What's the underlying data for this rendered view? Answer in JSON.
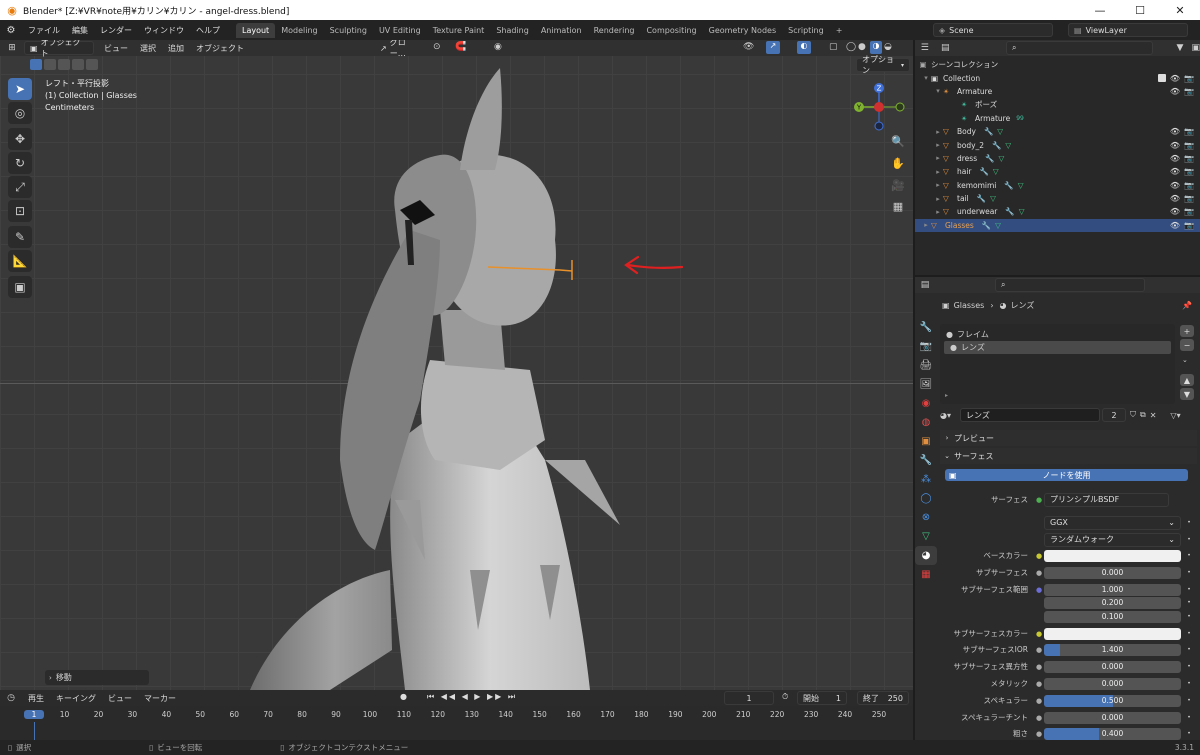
{
  "window": {
    "title": "Blender* [Z:¥VR¥note用¥カリン¥カリン - angel-dress.blend]",
    "minimize_glyph": "—",
    "maximize_glyph": "☐",
    "close_glyph": "✕"
  },
  "menubar": {
    "items": [
      "ファイル",
      "編集",
      "レンダー",
      "ウィンドウ",
      "ヘルプ"
    ],
    "workspace_tabs": [
      "Layout",
      "Modeling",
      "Sculpting",
      "UV Editing",
      "Texture Paint",
      "Shading",
      "Animation",
      "Rendering",
      "Compositing",
      "Geometry Nodes",
      "Scripting"
    ],
    "active_tab": "Layout",
    "add_tab": "+",
    "scene": "Scene",
    "view_layer": "ViewLayer"
  },
  "viewport": {
    "mode": "オブジェクト",
    "menu": [
      "ビュー",
      "選択",
      "追加",
      "オブジェクト"
    ],
    "transform_orientation": "グロー…",
    "options_label": "オプション",
    "overlay_lines": [
      "レフト・平行投影",
      "(1) Collection | Glasses",
      "Centimeters"
    ],
    "last_op_label": "移動",
    "gizmo_axes": {
      "x": "X",
      "y": "Y",
      "z": "Z"
    },
    "annotation_color": "#e02020",
    "glasses_color": "#e8902a"
  },
  "timeline": {
    "play_menu": "再生",
    "keying_menu": "キーイング",
    "view_menu": "ビュー",
    "marker_menu": "マーカー",
    "current_frame": "1",
    "start_label": "開始",
    "start_value": "1",
    "end_label": "終了",
    "end_value": "250",
    "ruler": [
      "1",
      "10",
      "20",
      "30",
      "40",
      "50",
      "60",
      "70",
      "80",
      "90",
      "100",
      "110",
      "120",
      "130",
      "140",
      "150",
      "160",
      "170",
      "180",
      "190",
      "200",
      "210",
      "220",
      "230",
      "240",
      "250"
    ]
  },
  "status": {
    "left": "選択",
    "middle": "ビューを回転",
    "right": "オブジェクトコンテクストメニュー",
    "version": "3.3.1"
  },
  "outliner": {
    "root": "シーンコレクション",
    "collection": "Collection",
    "rows": [
      {
        "name": "Armature",
        "icon": "armature-icon"
      },
      {
        "name": "ポーズ",
        "icon": "pose-icon"
      },
      {
        "name": "Armature",
        "icon": "armature-data-icon",
        "extra": "99"
      },
      {
        "name": "Body",
        "icon": "mesh-icon"
      },
      {
        "name": "body_2",
        "icon": "mesh-icon"
      },
      {
        "name": "dress",
        "icon": "mesh-icon"
      },
      {
        "name": "hair",
        "icon": "mesh-icon"
      },
      {
        "name": "kemomimi",
        "icon": "mesh-icon"
      },
      {
        "name": "tail",
        "icon": "mesh-icon"
      },
      {
        "name": "underwear",
        "icon": "mesh-icon"
      },
      {
        "name": "Glasses",
        "icon": "mesh-icon",
        "selected": true
      }
    ]
  },
  "properties": {
    "breadcrumb_object": "Glasses",
    "breadcrumb_material": "レンズ",
    "slots": [
      "フレイム",
      "レンズ"
    ],
    "active_slot": "レンズ",
    "material_name": "レンズ",
    "user_count": "2",
    "panel_preview": "プレビュー",
    "panel_surface": "サーフェス",
    "use_nodes": "ノードを使用",
    "surface_label": "サーフェス",
    "surface_value": "プリンシプルBSDF",
    "distribution": "GGX",
    "subsurface_method": "ランダムウォーク",
    "fields": [
      {
        "label": "ベースカラー",
        "type": "color",
        "color": "#f0f0f0"
      },
      {
        "label": "サブサーフェス",
        "value": "0.000",
        "fraction": 0
      },
      {
        "label": "サブサーフェス範囲",
        "value": "1.000"
      },
      {
        "label": "",
        "value": "0.200"
      },
      {
        "label": "",
        "value": "0.100"
      },
      {
        "label": "サブサーフェスカラー",
        "type": "color",
        "color": "#f0f0f0"
      },
      {
        "label": "サブサーフェスIOR",
        "value": "1.400",
        "fraction": 0.12
      },
      {
        "label": "サブサーフェス異方性",
        "value": "0.000",
        "fraction": 0
      },
      {
        "label": "メタリック",
        "value": "0.000",
        "fraction": 0
      },
      {
        "label": "スペキュラー",
        "value": "0.500",
        "fraction": 0.5
      },
      {
        "label": "スペキュラーチント",
        "value": "0.000",
        "fraction": 0
      },
      {
        "label": "粗さ",
        "value": "0.400",
        "fraction": 0.4
      }
    ]
  }
}
